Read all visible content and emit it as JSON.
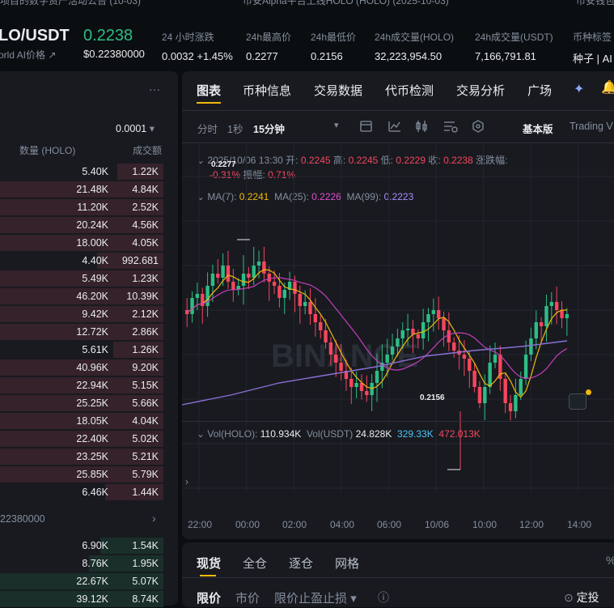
{
  "ticker": {
    "items": [
      "项目的数字资产活动公告 (10-03)",
      "币安Alpha平台上线HOLO (HOLO) (2025-10-03)",
      "币安钱包"
    ]
  },
  "header": {
    "symbol": "LO/USDT",
    "price": "0.2238",
    "price_usd": "$0.22380000",
    "sub_label": "orld AI价格",
    "stats": [
      {
        "label": "24 小时涨跌",
        "value": "0.0032 +1.45%"
      },
      {
        "label": "24h最高价",
        "value": "0.2277"
      },
      {
        "label": "24h最低价",
        "value": "0.2156"
      },
      {
        "label": "24h成交量(HOLO)",
        "value": "32,223,954.50"
      },
      {
        "label": "24h成交量(USDT)",
        "value": "7,166,791.81"
      },
      {
        "label": "币种标签",
        "value": "种子 | AI"
      }
    ]
  },
  "book": {
    "more": "···",
    "precision": "0.0001",
    "col_qty": "数量 (HOLO)",
    "col_amt": "成交额",
    "asks": [
      {
        "qty": "5.40K",
        "amt": "1.22K",
        "depth": 0.28
      },
      {
        "qty": "21.48K",
        "amt": "4.84K",
        "depth": 1.0
      },
      {
        "qty": "11.20K",
        "amt": "2.52K",
        "depth": 1.0
      },
      {
        "qty": "20.24K",
        "amt": "4.56K",
        "depth": 1.0
      },
      {
        "qty": "18.00K",
        "amt": "4.05K",
        "depth": 1.0
      },
      {
        "qty": "4.40K",
        "amt": "992.681",
        "depth": 0.4
      },
      {
        "qty": "5.49K",
        "amt": "1.23K",
        "depth": 1.0
      },
      {
        "qty": "46.20K",
        "amt": "10.39K",
        "depth": 1.0
      },
      {
        "qty": "9.42K",
        "amt": "2.12K",
        "depth": 1.0
      },
      {
        "qty": "12.72K",
        "amt": "2.86K",
        "depth": 1.0
      },
      {
        "qty": "5.61K",
        "amt": "1.26K",
        "depth": 0.3
      },
      {
        "qty": "40.96K",
        "amt": "9.20K",
        "depth": 1.0
      },
      {
        "qty": "22.94K",
        "amt": "5.15K",
        "depth": 1.0
      },
      {
        "qty": "25.25K",
        "amt": "5.66K",
        "depth": 1.0
      },
      {
        "qty": "18.05K",
        "amt": "4.04K",
        "depth": 1.0
      },
      {
        "qty": "22.40K",
        "amt": "5.02K",
        "depth": 1.0
      },
      {
        "qty": "23.25K",
        "amt": "5.21K",
        "depth": 1.0
      },
      {
        "qty": "25.85K",
        "amt": "5.79K",
        "depth": 1.0
      },
      {
        "qty": "6.46K",
        "amt": "1.44K",
        "depth": 0.35
      }
    ],
    "mid_price": "22380000",
    "bids": [
      {
        "qty": "6.90K",
        "amt": "1.54K",
        "depth": 0.38
      },
      {
        "qty": "8.76K",
        "amt": "1.95K",
        "depth": 0.45
      },
      {
        "qty": "22.67K",
        "amt": "5.07K",
        "depth": 1.0
      },
      {
        "qty": "39.12K",
        "amt": "8.74K",
        "depth": 1.0
      }
    ]
  },
  "chart": {
    "tabs": [
      "图表",
      "币种信息",
      "交易数据",
      "代币检测",
      "交易分析",
      "广场"
    ],
    "intervals": [
      "分时",
      "1秒",
      "15分钟"
    ],
    "view_basic": "基本版",
    "view_tv": "Trading V",
    "ohlc": {
      "datetime": "2025/10/06 13:30",
      "open_label": "开:",
      "open": "0.2245",
      "high_label": "高:",
      "high": "0.2245",
      "low_label": "低:",
      "low": "0.2229",
      "close_label": "收:",
      "close": "0.2238",
      "chg_label": "涨跌幅:",
      "chg": "-0.31%",
      "amp_label": "振幅:",
      "amp": "0.71%"
    },
    "ma": {
      "ma7_label": "MA(7):",
      "ma7": "0.2241",
      "ma25_label": "MA(25):",
      "ma25": "0.2226",
      "ma99_label": "MA(99):",
      "ma99": "0.2223"
    },
    "high_mark": "0.2277",
    "low_mark": "0.2156",
    "watermark": "BINANCE",
    "vol": {
      "holo_label": "Vol(HOLO):",
      "holo": "110.934K",
      "usdt_label": "Vol(USDT)",
      "usdt": "24.828K",
      "v1": "329.33K",
      "v2": "472.013K"
    },
    "xaxis": [
      "22:00",
      "00:00",
      "02:00",
      "04:00",
      "06:00",
      "10/06",
      "10:00",
      "12:00",
      "14:00"
    ]
  },
  "trade": {
    "tabs": [
      "现货",
      "全仓",
      "逐仓",
      "网格"
    ],
    "order_types": [
      "限价",
      "市价",
      "限价止盈止损"
    ],
    "fee_label": "定投",
    "pct": "%"
  },
  "colors": {
    "up": "#2ebd85",
    "down": "#f6465d",
    "ma7": "#f0b90b",
    "ma25": "#c33fb8",
    "ma99": "#8a6fd6",
    "bg": "#0b0e11",
    "panel": "#181a20"
  }
}
